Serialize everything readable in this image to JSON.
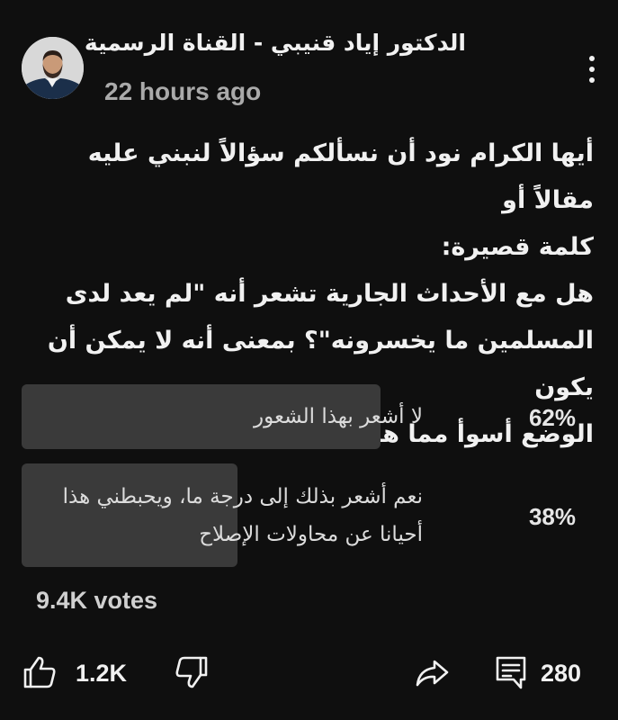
{
  "post": {
    "channel_name": "الدكتور إياد قنيبي - القناة الرسمية",
    "time_ago": "22 hours ago",
    "question": "أيها الكرام نود أن نسألكم سؤالاً لنبني عليه مقالاً أو\nكلمة قصيرة:\nهل مع الأحداث الجارية تشعر أنه \"لم يعد لدى\nالمسلمين ما يخسرونه\"؟ بمعنى أنه لا يمكن أن يكون\nالوضع أسوأ مما هو عليه؟"
  },
  "poll": {
    "options": [
      {
        "text": "لا أشعر بهذا الشعور",
        "percent_label": "62%",
        "percent": 62
      },
      {
        "text": "نعم أشعر بذلك إلى درجة ما، ويحبطني هذا\nأحيانا عن محاولات الإصلاح",
        "percent_label": "38%",
        "percent": 38
      }
    ],
    "votes": "9.4K votes"
  },
  "actions": {
    "likes": "1.2K",
    "comments": "280",
    "icons": [
      "thumb-up-icon",
      "thumb-down-icon",
      "share-icon",
      "comment-icon"
    ]
  },
  "colors": {
    "background": "#0f0f0f",
    "poll_fill": "#3a3a3a",
    "text_primary": "#f1f1f1",
    "text_secondary": "#aaaaaa"
  }
}
